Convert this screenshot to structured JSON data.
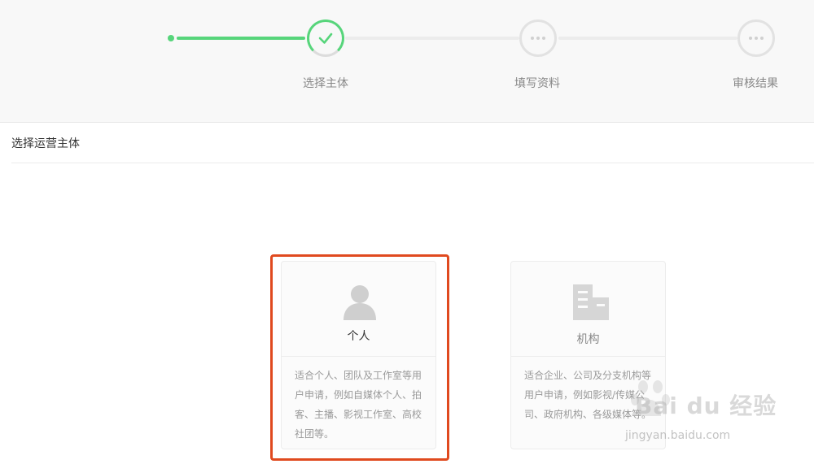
{
  "stepper": {
    "steps": [
      {
        "label": "选择主体",
        "state": "done"
      },
      {
        "label": "填写资料",
        "state": "pending"
      },
      {
        "label": "审核结果",
        "state": "pending"
      }
    ],
    "colors": {
      "done": "#57d57b",
      "pending": "#e2e2e2"
    }
  },
  "section": {
    "title": "选择运营主体"
  },
  "cards": {
    "personal": {
      "title": "个人",
      "description": "适合个人、团队及工作室等用户申请，例如自媒体个人、拍客、主播、影视工作室、高校社团等。",
      "icon": "user-icon",
      "selected": true
    },
    "org": {
      "title": "机构",
      "description": "适合企业、公司及分支机构等用户申请，例如影视/传媒公司、政府机构、各级媒体等。",
      "icon": "building-icon",
      "selected": false
    }
  },
  "highlight_color": "#e04a1f",
  "watermark": {
    "text": "Bai du 经验",
    "sub": "jingyan.baidu.com"
  }
}
